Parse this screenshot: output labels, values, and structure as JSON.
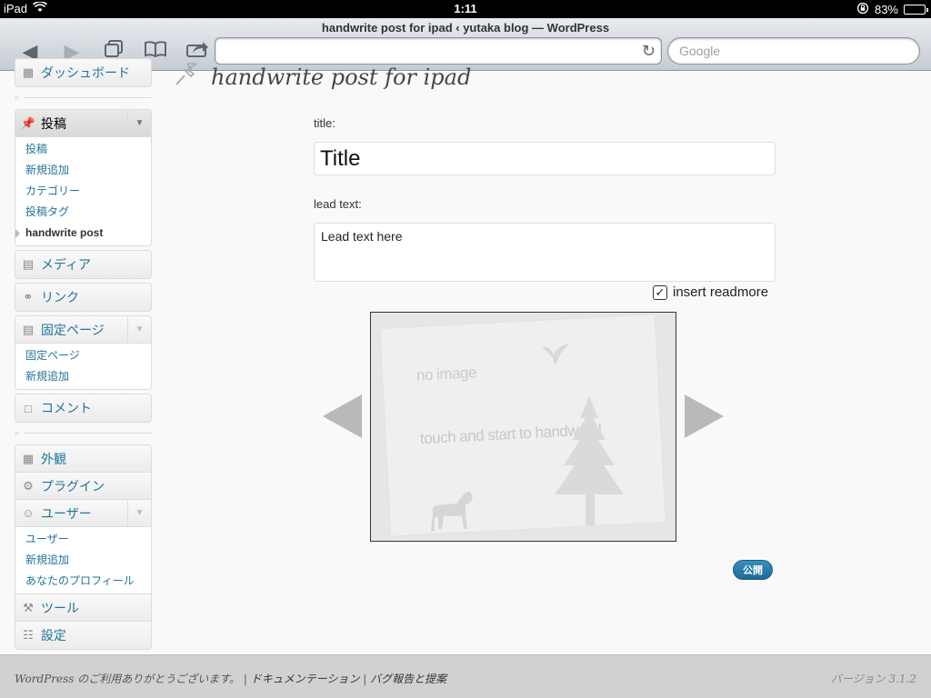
{
  "status_bar": {
    "device": "iPad",
    "time": "1:11",
    "battery": "83%",
    "battery_level": 0.83
  },
  "browser": {
    "page_title": "handwrite post for ipad ‹ yutaka blog — WordPress",
    "url": "",
    "search_placeholder": "Google"
  },
  "sidebar": {
    "dashboard_label": "ダッシュボード",
    "posts": {
      "label": "投稿",
      "items": [
        "投稿",
        "新規追加",
        "カテゴリー",
        "投稿タグ",
        "handwrite post"
      ]
    },
    "media_label": "メディア",
    "links_label": "リンク",
    "pages": {
      "label": "固定ページ",
      "items": [
        "固定ページ",
        "新規追加"
      ]
    },
    "comments_label": "コメント",
    "appearance_label": "外観",
    "plugins_label": "プラグイン",
    "users": {
      "label": "ユーザー",
      "items": [
        "ユーザー",
        "新規追加",
        "あなたのプロフィール"
      ]
    },
    "tools_label": "ツール",
    "settings_label": "設定"
  },
  "main": {
    "heading": "handwrite post for ipad",
    "title_label": "title:",
    "title_value": "Title",
    "lead_label": "lead text:",
    "lead_value": "Lead text here",
    "readmore_label": "insert readmore",
    "readmore_checked": true,
    "canvas": {
      "no_image_text": "no image",
      "touch_text": "touch and start to handwrite!"
    },
    "publish_label": "公開"
  },
  "footer": {
    "thanks_text": "WordPress のご利用ありがとうございます。",
    "docs_link": "ドキュメンテーション",
    "feedback_link": "バグ報告と提案",
    "version": "バージョン 3.1.2"
  }
}
